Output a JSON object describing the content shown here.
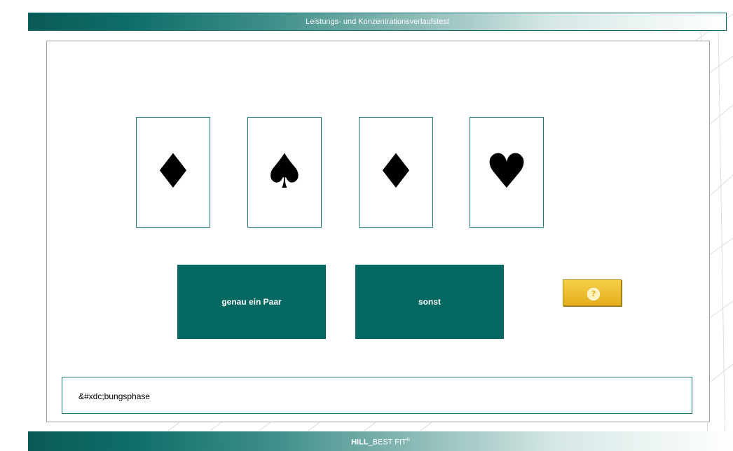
{
  "header": {
    "title": "Leistungs- und Konzentrationsverlaufstest"
  },
  "cards": [
    {
      "suit": "diamond",
      "glyph": "♦"
    },
    {
      "suit": "spade",
      "glyph": "♠"
    },
    {
      "suit": "diamond",
      "glyph": "♦"
    },
    {
      "suit": "heart",
      "glyph": "♥"
    }
  ],
  "buttons": {
    "pair_label": "genau ein Paar",
    "other_label": "sonst",
    "help_icon": "question-icon",
    "help_glyph": "?"
  },
  "status": {
    "text": "&#xdc;bungsphase"
  },
  "footer": {
    "brand_bold": "HILL",
    "brand_rest": "_BEST FIT",
    "brand_mark": "®"
  },
  "colors": {
    "accent": "#046862",
    "help": "#F0BE30"
  }
}
